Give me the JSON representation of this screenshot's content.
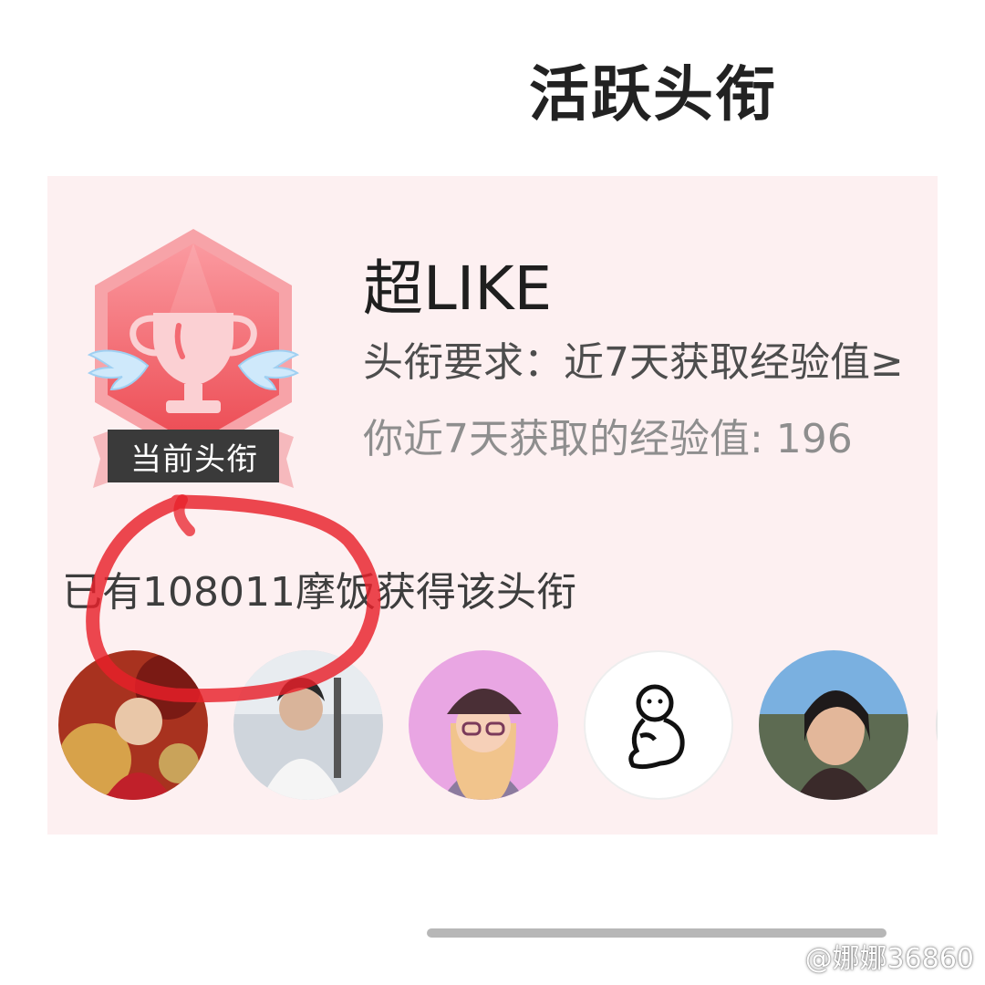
{
  "page": {
    "title": "活跃头衔"
  },
  "title_card": {
    "badge_label": "当前头衔",
    "name": "超LIKE",
    "requirement": "头衔要求：近7天获取经验值≥",
    "your_exp": "你近7天获取的经验值: 196",
    "holders_text": "已有108011摩饭获得该头衔",
    "avatars": [
      {
        "name": "avatar-1"
      },
      {
        "name": "avatar-2"
      },
      {
        "name": "avatar-3"
      },
      {
        "name": "avatar-4"
      },
      {
        "name": "avatar-5"
      },
      {
        "name": "avatar-6-partial"
      }
    ]
  },
  "watermark": {
    "icon": "weibo-icon",
    "text": "@娜娜36860"
  },
  "colors": {
    "card_bg": "#fdf0f1",
    "badge_red": "#f0565e",
    "annotation_red": "#e8202a"
  }
}
